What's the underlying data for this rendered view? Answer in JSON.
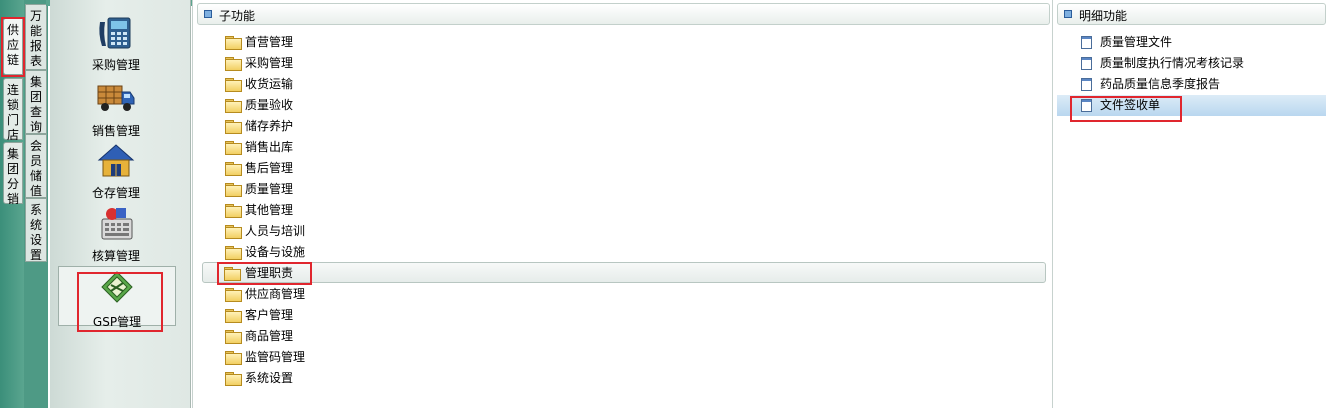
{
  "outer_tabs": [
    {
      "label": [
        "供",
        "应",
        "链"
      ],
      "active": true
    },
    {
      "label": [
        "连",
        "锁",
        "门",
        "店"
      ]
    },
    {
      "label": [
        "集",
        "团",
        "分",
        "销"
      ]
    }
  ],
  "inner_tabs": [
    {
      "label": [
        "万",
        "能",
        "报",
        "表"
      ]
    },
    {
      "label": [
        "集",
        "团",
        "查",
        "询"
      ]
    },
    {
      "label": [
        "会",
        "员",
        "储",
        "值"
      ]
    },
    {
      "label": [
        "系",
        "统",
        "设",
        "置"
      ]
    }
  ],
  "modules": [
    {
      "label": "采购管理",
      "icon": "phone-fax-icon"
    },
    {
      "label": "销售管理",
      "icon": "delivery-truck-icon"
    },
    {
      "label": "仓存管理",
      "icon": "warehouse-house-icon"
    },
    {
      "label": "核算管理",
      "icon": "calculator-icon"
    },
    {
      "label": "GSP管理",
      "icon": "gsp-diamond-icon"
    }
  ],
  "subfunc": {
    "title": "子功能",
    "items": [
      "首营管理",
      "采购管理",
      "收货运输",
      "质量验收",
      "储存养护",
      "销售出库",
      "售后管理",
      "质量管理",
      "其他管理",
      "人员与培训",
      "设备与设施",
      "管理职责",
      "供应商管理",
      "客户管理",
      "商品管理",
      "监管码管理",
      "系统设置"
    ],
    "selected_index": 11
  },
  "detail": {
    "title": "明细功能",
    "items": [
      "质量管理文件",
      "质量制度执行情况考核记录",
      "药品质量信息季度报告",
      "文件签收单"
    ],
    "selected_index": 3
  }
}
